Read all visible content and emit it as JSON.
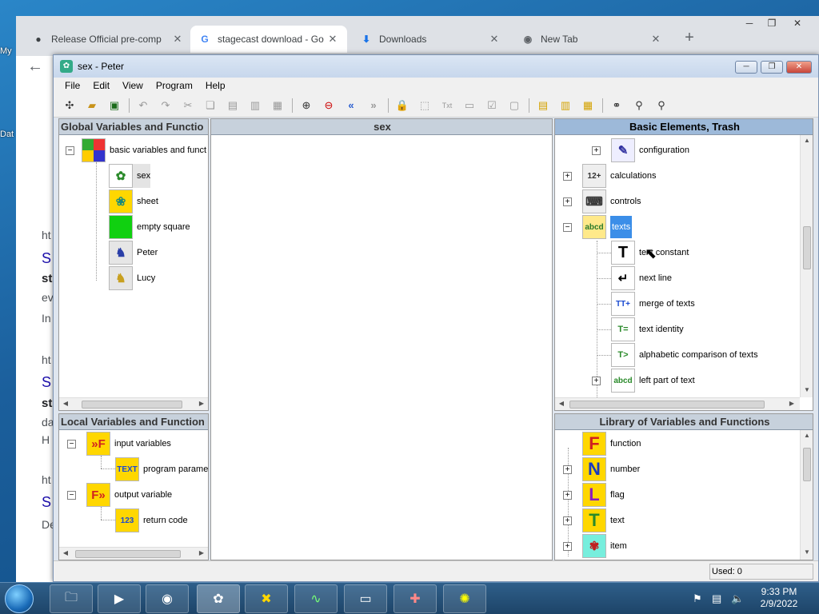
{
  "desktop": {
    "icon1_label": "My",
    "icon2_label": "Dat"
  },
  "chrome": {
    "tabs": [
      {
        "title": "Release Official pre-comp",
        "icon": "github-icon"
      },
      {
        "title": "stagecast download - Go",
        "icon": "google-icon"
      },
      {
        "title": "Downloads",
        "icon": "download-icon"
      },
      {
        "title": "New Tab",
        "icon": "chrome-icon"
      }
    ],
    "page_fragments": [
      "ht",
      "S",
      "st",
      "ev",
      "In",
      "ht",
      "S",
      "st",
      "da",
      "H",
      "ht",
      "S",
      "De"
    ]
  },
  "app": {
    "title": "sex - Peter",
    "menu": [
      "File",
      "Edit",
      "View",
      "Program",
      "Help"
    ],
    "toolbar_icons": [
      "new-icon",
      "open-icon",
      "save-icon",
      "undo-icon",
      "redo-icon",
      "cut-icon",
      "copy-icon",
      "paste-icon",
      "delete-icon",
      "select-all-icon",
      "zoom-in-icon",
      "zoom-out-icon",
      "rewind-icon",
      "forward-icon",
      "lock-icon",
      "grid-icon",
      "text-icon",
      "text-box-icon",
      "check-icon",
      "screen-icon",
      "folder-icon",
      "folder-up-icon",
      "folder-down-icon",
      "binoculars-icon",
      "find-icon",
      "find-next-icon"
    ],
    "panels": {
      "global": {
        "header": "Global Variables and Functio",
        "root": "basic variables and funct",
        "items": [
          "sex",
          "sheet",
          "empty square",
          "Peter",
          "Lucy"
        ]
      },
      "center": {
        "header": "sex"
      },
      "basic": {
        "header": "Basic Elements, Trash",
        "groups": [
          "configuration",
          "calculations",
          "controls",
          "texts"
        ],
        "children": [
          "text constant",
          "next line",
          "merge of texts",
          "text identity",
          "alphabetic comparison of texts",
          "left part of text"
        ]
      },
      "local": {
        "header": "Local Variables and Function",
        "items": [
          "input variables",
          "program parame",
          "output variable",
          "return code"
        ]
      },
      "library": {
        "header": "Library of Variables and Functions",
        "items": [
          "function",
          "number",
          "flag",
          "text",
          "item"
        ]
      }
    },
    "status": {
      "used": "Used: 0"
    }
  },
  "taskbar": {
    "time": "9:33 PM",
    "date": "2/9/2022"
  },
  "colors": {
    "panel_header": "#c7d1dc",
    "selected_header": "#9db9d9",
    "selection": "#3b8ee8"
  }
}
